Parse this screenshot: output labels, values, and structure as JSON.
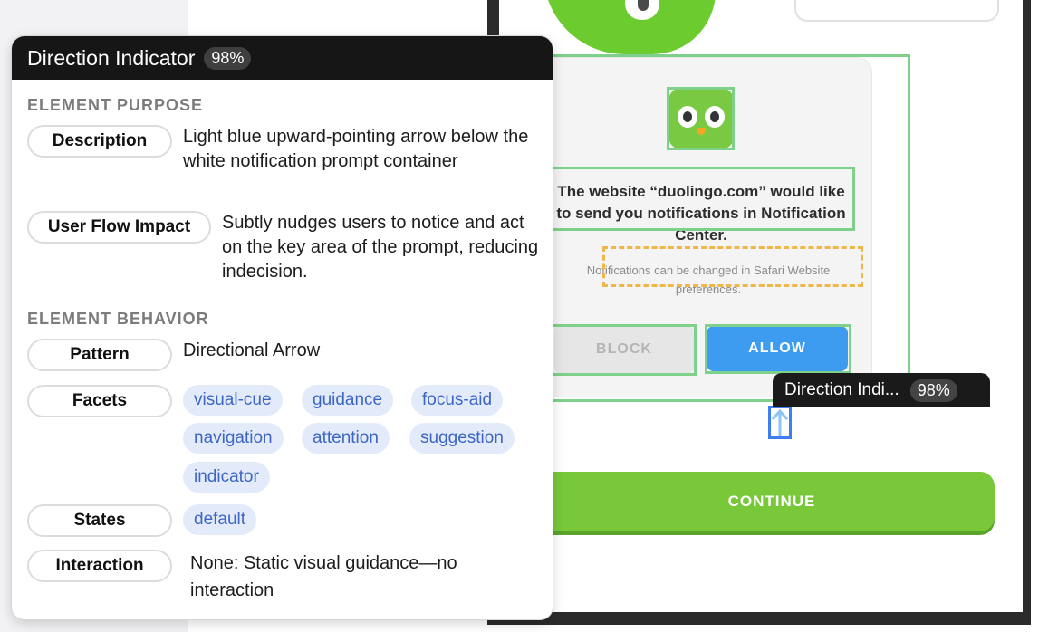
{
  "card": {
    "title": "Direction Indicator",
    "confidence": "98%",
    "sections": {
      "purpose": "ELEMENT PURPOSE",
      "behavior": "ELEMENT BEHAVIOR"
    },
    "labels": {
      "description": "Description",
      "user_flow_impact": "User Flow Impact",
      "pattern": "Pattern",
      "facets": "Facets",
      "states": "States",
      "interaction": "Interaction"
    },
    "description": "Light blue upward-pointing arrow below the white notification prompt container",
    "user_flow_impact": "Subtly nudges users to notice and act on the key area of the prompt, reducing indecision.",
    "pattern": "Directional Arrow",
    "facets": [
      "visual-cue",
      "guidance",
      "focus-aid",
      "navigation",
      "attention",
      "suggestion",
      "indicator"
    ],
    "states": [
      "default"
    ],
    "interaction_prefix": "None:",
    "interaction_text": "Static visual guidance—no interaction"
  },
  "overlay_label": {
    "text": "Direction Indi...",
    "confidence": "98%"
  },
  "prompt": {
    "title": "The website “duolingo.com” would like to send you notifications in Notification Center.",
    "subtitle": "Notifications can be changed in Safari Website preferences.",
    "block_label": "BLOCK",
    "allow_label": "ALLOW"
  },
  "continue_label": "CONTINUE",
  "colors": {
    "highlight_green": "#7fd08a",
    "highlight_orange": "#efb64a",
    "highlight_blue": "#3d7ef0",
    "allow_blue": "#3d9cf0",
    "continue_green": "#78c83a",
    "tag_bg": "#e3ebfb",
    "tag_text": "#3d66c4"
  },
  "icons": {
    "arrow": "arrow-up-icon",
    "app": "duolingo-owl-icon"
  }
}
